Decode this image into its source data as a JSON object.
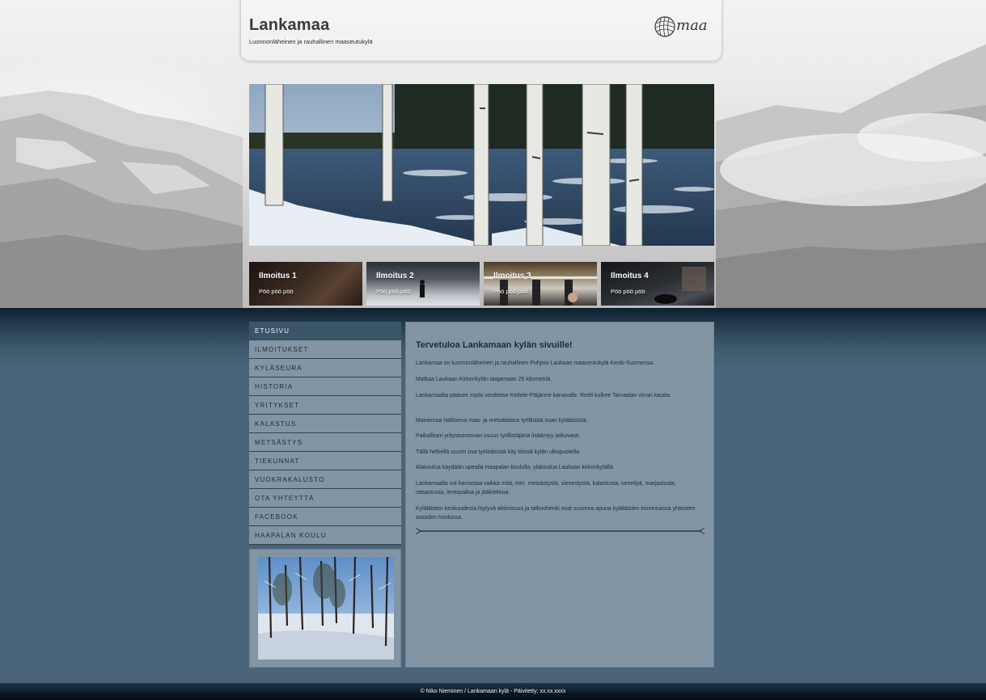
{
  "site": {
    "title": "Lankamaa",
    "tagline": "Luonnonläheinen ja rauhallinen maaseutukylä",
    "logo_text": "maa"
  },
  "ads": [
    {
      "title": "Ilmoitus 1",
      "text": "Pöö pöö pöö"
    },
    {
      "title": "Ilmoitus 2",
      "text": "Pöö pöö pöö"
    },
    {
      "title": "Ilmoitus 3",
      "text": "Pöö pöö pöö"
    },
    {
      "title": "Ilmoitus 4",
      "text": "Pöö pöö pöö"
    }
  ],
  "nav": {
    "items": [
      {
        "label": "ETUSIVU",
        "active": true
      },
      {
        "label": "ILMOITUKSET"
      },
      {
        "label": "KYLÄSEURA"
      },
      {
        "label": "HISTORIA"
      },
      {
        "label": "YRITYKSET"
      },
      {
        "label": "KALASTUS"
      },
      {
        "label": "METSÄSTYS"
      },
      {
        "label": "TIEKUNNAT"
      },
      {
        "label": "VUOKRAKALUSTO"
      },
      {
        "label": "OTA YHTEYTTÄ"
      },
      {
        "label": "FACEBOOK"
      },
      {
        "label": "HAAPALAN KOULU"
      }
    ]
  },
  "main": {
    "title": "Tervetuloa Lankamaan kylän sivuille!",
    "paragraphs": [
      "Lankamaa on luonnonläheinen ja rauhallinen Pohjois-Laukaan maaseutukylä Keski-Suomessa.",
      "Matkaa Laukaan Kirkonkylän taajamaan 25 kilometriä.",
      "Lankamaalta pääsee myös vesiteitse Keitele-Päijänne kanavalle. Reitti kulkee Tarvaalan virran kautta.",
      "Maisemaa hallitseva maa- ja metsätalous työllistää osan kyläläisistä.",
      "Paikallisen yritystoiminnan osuus työllistäjänä lisääntyy jatkuvasti.",
      "Tällä hetkellä suurin osa työikäisistä käy töissä kylän ulkopuolella.",
      "Alakoulua käydään upealla Haapalan koululla, yläkoulua Laukaan kirkonkylällä.",
      "Lankamaalla voi harrastaa vaikka mitä, mm. metsästystä, sienestystä, kalastusta, veneilyä, marjastusta, ratsastusta, lentopalloa ja jääkiekkoa.",
      "Kyläläisten keskuudesta löytyvä aktiivisuus ja talkoohenki ovat suurena apuna kyläläisten toiminnassa yhteisten asioiden hoidossa."
    ]
  },
  "footer": {
    "text": "© Niko Nieminen / Lankamaan kylä - Päivitetty: xx.xx.xxxx"
  },
  "colors": {
    "nav_bg": "#8295a4",
    "nav_active_bg": "#3b5568",
    "page_bg": "#4a6479",
    "content_bg": "#8295a4"
  }
}
